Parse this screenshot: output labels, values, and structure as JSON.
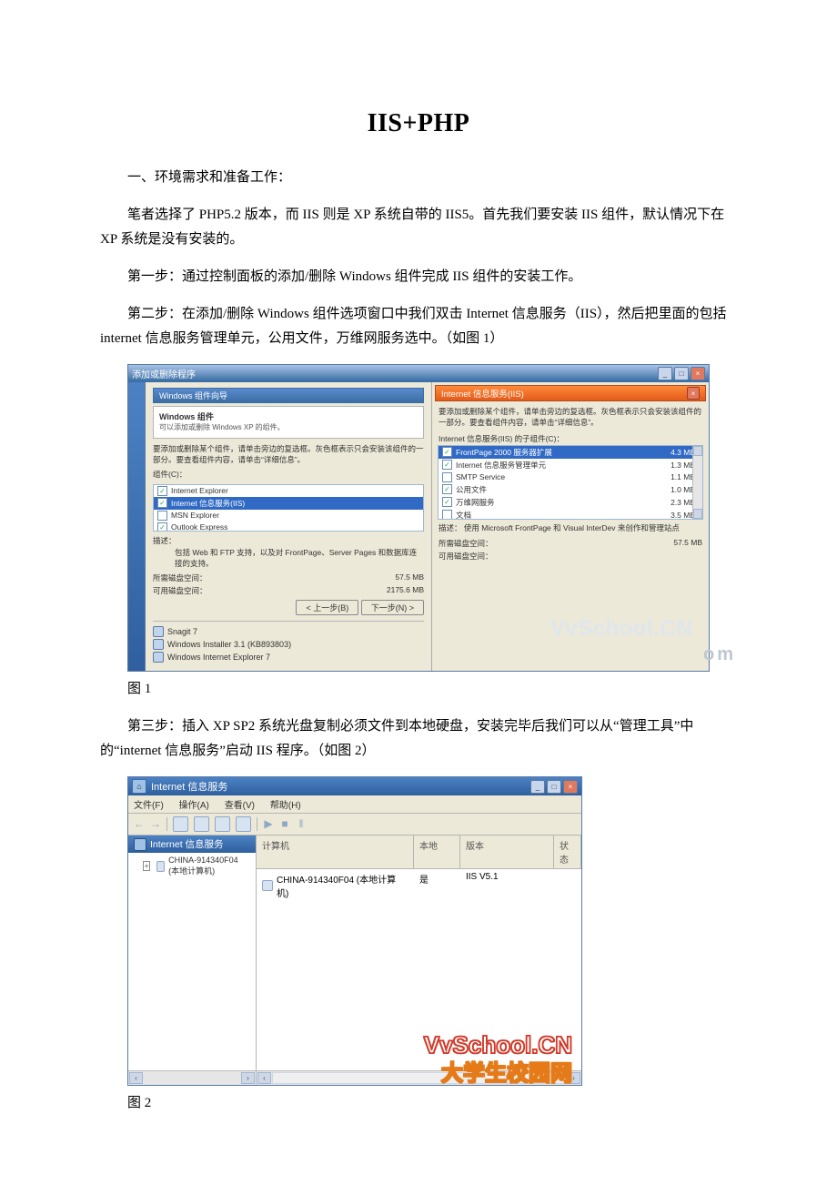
{
  "title": "IIS+PHP",
  "para1": "一、环境需求和准备工作：",
  "para2": "笔者选择了 PHP5.2 版本，而 IIS 则是 XP 系统自带的 IIS5。首先我们要安装 IIS 组件，默认情况下在 XP 系统是没有安装的。",
  "para3": "第一步：通过控制面板的添加/删除 Windows 组件完成 IIS 组件的安装工作。",
  "para4": "第二步：在添加/删除 Windows 组件选项窗口中我们双击 Internet 信息服务（IIS），然后把里面的包括 internet 信息服务管理单元，公用文件，万维网服务选中。（如图 1）",
  "figure1_caption": "图 1",
  "para5": "第三步：插入 XP SP2 系统光盘复制必须文件到本地硬盘，安装完毕后我们可以从“管理工具”中的“internet 信息服务”启动 IIS 程序。（如图 2）",
  "figure2_caption": "图 2",
  "fig1": {
    "outer_title": "添加或删除程序",
    "wizard_title": "Windows 组件向导",
    "header_main": "Windows 组件",
    "header_sub": "可以添加或删除 Windows XP 的组件。",
    "desc": "要添加或删除某个组件，请单击旁边的复选框。灰色框表示只会安装该组件的一部分。要查看组件内容，请单击“详细信息”。",
    "comp_label": "组件(C)：",
    "components": [
      {
        "name": "Internet Explorer",
        "checked": true
      },
      {
        "name": "Internet 信息服务(IIS)",
        "checked": true,
        "selected": true
      },
      {
        "name": "MSN Explorer",
        "checked": false
      },
      {
        "name": "Outlook Express",
        "checked": true
      }
    ],
    "note_label": "描述：",
    "note_text": "包括 Web 和 FTP 支持，以及对 FrontPage、Server Pages 和数据库连接的支持。",
    "req_space_label": "所需磁盘空间：",
    "req_space_val": "57.5 MB",
    "free_space_label": "可用磁盘空间：",
    "free_space_val": "2175.6 MB",
    "back_btn": "< 上一步(B)",
    "next_btn": "下一步(N) >",
    "progs": [
      "Snagit 7",
      "Windows Installer 3.1 (KB893803)",
      "Windows Internet Explorer 7"
    ],
    "iis": {
      "title": "Internet 信息服务(IIS)",
      "desc": "要添加或删除某个组件，请单击旁边的复选框。灰色框表示只会安装该组件的一部分。要查看组件内容，请单击“详细信息”。",
      "sub_label": "Internet 信息服务(IIS) 的子组件(C)：",
      "items": [
        {
          "name": "FrontPage 2000 服务器扩展",
          "size": "4.3 MB",
          "checked": true,
          "selected": true
        },
        {
          "name": "Internet 信息服务管理单元",
          "size": "1.3 MB",
          "checked": true
        },
        {
          "name": "SMTP Service",
          "size": "1.1 MB",
          "checked": false
        },
        {
          "name": "公用文件",
          "size": "1.0 MB",
          "checked": true
        },
        {
          "name": "万维网服务",
          "size": "2.3 MB",
          "checked": true
        },
        {
          "name": "文档",
          "size": "3.5 MB",
          "checked": false
        }
      ],
      "note_label": "描述：",
      "note_text": "使用 Microsoft FrontPage 和 Visual InterDev 来创作和管理站点",
      "req_space_label": "所需磁盘空间：",
      "req_space_val": "57.5 MB",
      "free_space_label": "可用磁盘空间："
    },
    "watermark_a": "VvSchool.CN",
    "watermark_b": "om"
  },
  "fig2": {
    "title": "Internet  信息服务",
    "menu": {
      "file": "文件(F)",
      "action": "操作(A)",
      "view": "查看(V)",
      "help": "帮助(H)"
    },
    "tree_root": "Internet 信息服务",
    "tree_node": "CHINA-914340F04 (本地计算机)",
    "cols": {
      "c1": "计算机",
      "c2": "本地",
      "c3": "版本",
      "c4": "状态"
    },
    "row": {
      "c1": "CHINA-914340F04 (本地计算机)",
      "c2": "是",
      "c3": "IIS V5.1",
      "c4": ""
    },
    "watermark_a": "VvSchool.CN",
    "watermark_b": "大学生校园网"
  }
}
